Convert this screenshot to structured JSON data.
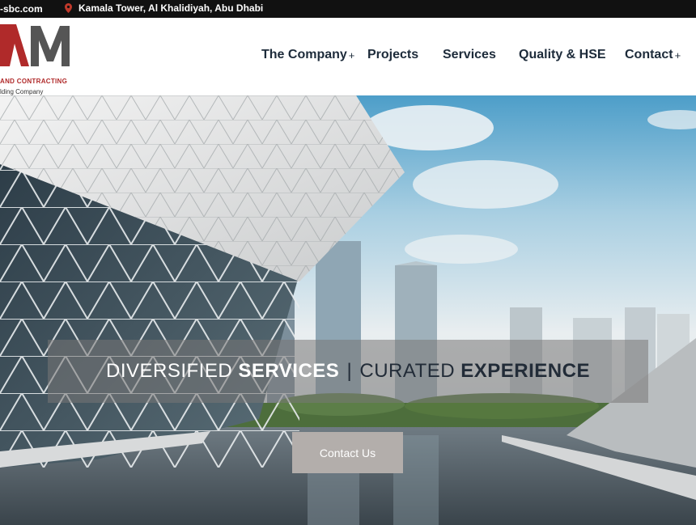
{
  "topbar": {
    "email": "-sbc.com",
    "location": "Kamala Tower, Al Khalidiyah, Abu Dhabi",
    "location_icon": "map-pin-icon"
  },
  "logo": {
    "mark": "AM",
    "line1": "AND CONTRACTING",
    "line2": "lding Company",
    "accent_color": "#b02a2a"
  },
  "nav": {
    "items": [
      {
        "label": "The Company",
        "has_submenu": true,
        "submenu_icon": "+"
      },
      {
        "label": "Projects",
        "has_submenu": false
      },
      {
        "label": "Services",
        "has_submenu": false
      },
      {
        "label": "Quality & HSE",
        "has_submenu": false
      },
      {
        "label": "Contact",
        "has_submenu": true,
        "submenu_icon": "+"
      }
    ]
  },
  "hero": {
    "banner": {
      "part1_thin": "DIVERSIFIED ",
      "part1_bold": "SERVICES",
      "separator": "|",
      "part2_thin": "CURATED ",
      "part2_bold": "EXPERIENCE"
    },
    "cta_label": "Contact Us",
    "cta_color": "#b3aeab"
  }
}
